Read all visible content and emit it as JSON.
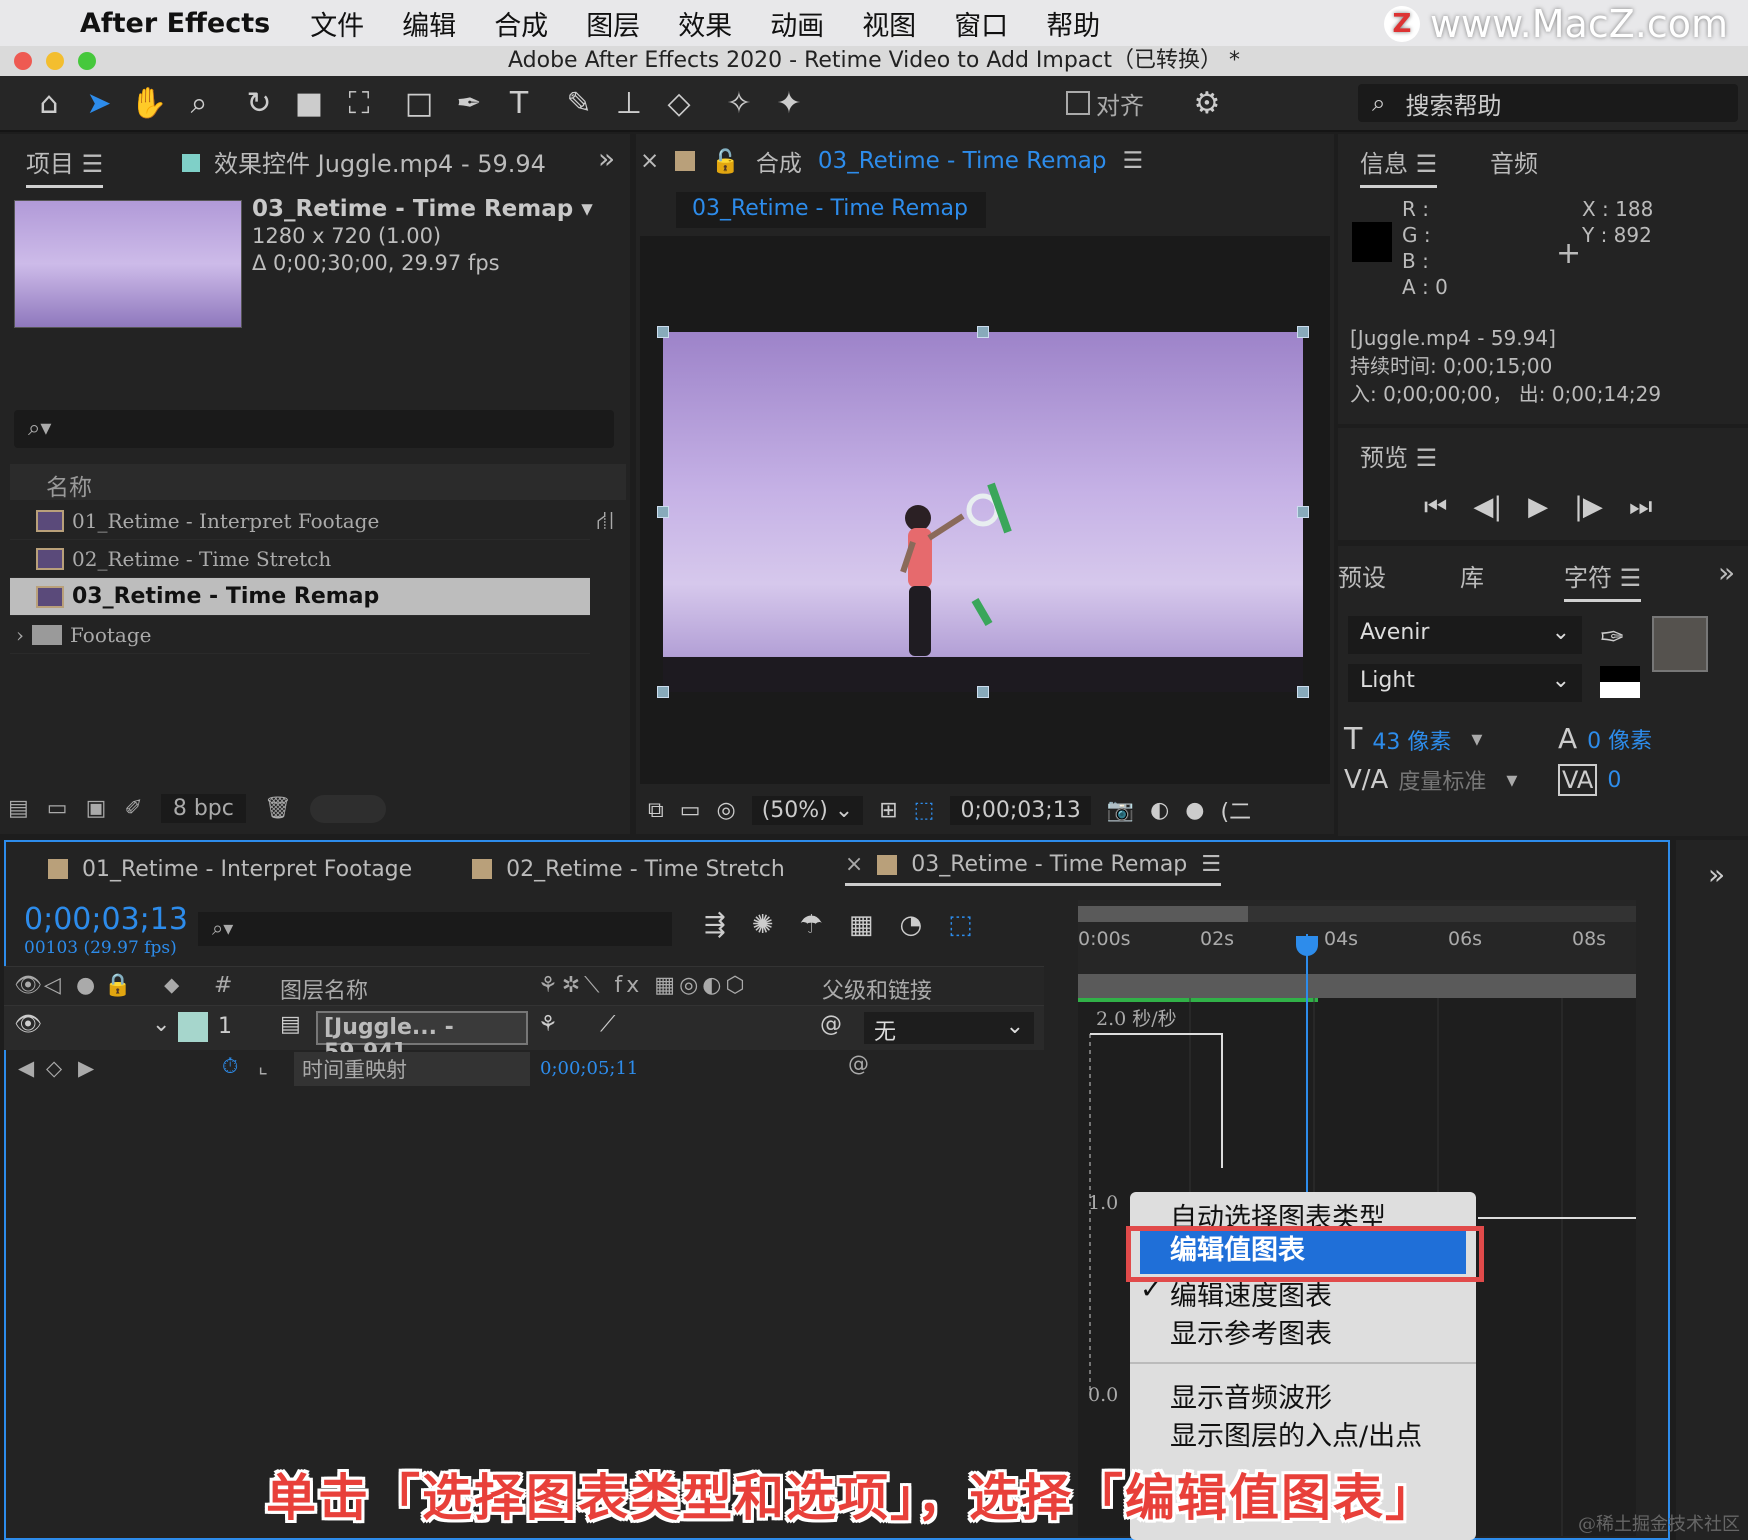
{
  "menubar": {
    "app": "After Effects",
    "items": [
      "文件",
      "编辑",
      "合成",
      "图层",
      "效果",
      "动画",
      "视图",
      "窗口",
      "帮助"
    ],
    "watermark": "www.MacZ.com",
    "watermark_badge": "Z"
  },
  "window": {
    "title": "Adobe After Effects 2020 - Retime Video to Add Impact（已转换） *"
  },
  "toolbar": {
    "align_label": "对齐",
    "search_placeholder": "搜索帮助"
  },
  "project": {
    "tab_label": "项目",
    "effects_tab": "效果控件 Juggle.mp4 - 59.94",
    "selected_name": "03_Retime - Time Remap",
    "resolution": "1280 x 720 (1.00)",
    "duration": "Δ 0;00;30;00, 29.97 fps",
    "column_name": "名称",
    "items": [
      "01_Retime - Interpret Footage",
      "02_Retime - Time Stretch",
      "03_Retime - Time Remap",
      "Footage"
    ],
    "bpc": "8 bpc"
  },
  "composition": {
    "tab_prefix": "合成",
    "tab_name": "03_Retime - Time Remap",
    "subtab": "03_Retime - Time Remap",
    "zoom": "(50%)",
    "timecode": "0;00;03;13"
  },
  "info": {
    "tab": "信息",
    "audio_tab": "音频",
    "r": "R :",
    "g": "G :",
    "b": "B :",
    "a": "A :  0",
    "x": "X : 188",
    "y": "Y : 892",
    "source": "[Juggle.mp4 - 59.94]",
    "duration": "持续时间: 0;00;15;00",
    "inout": "入: 0;00;00;00，  出: 0;00;14;29"
  },
  "preview": {
    "tab": "预览"
  },
  "character": {
    "tabs": [
      "预设",
      "库",
      "字符"
    ],
    "font": "Avenir",
    "style": "Light",
    "size": "43 像素",
    "leading": "0 像素",
    "kerning": "度量标准",
    "tracking": "0"
  },
  "timeline": {
    "tabs": [
      "01_Retime - Interpret Footage",
      "02_Retime - Time Stretch",
      "03_Retime - Time Remap"
    ],
    "time": "0;00;03;13",
    "frames": "00103 (29.97 fps)",
    "col_hash": "#",
    "col_layer_name": "图层名称",
    "col_parent": "父级和链接",
    "layer_num": "1",
    "layer_name": "[Juggle... - 59.94]",
    "parent": "无",
    "property": "时间重映射",
    "property_value": "0;00;05;11",
    "ruler": [
      "0:00s",
      "02s",
      "04s",
      "06s",
      "08s"
    ],
    "graph_speed": "2.0 秒/秒",
    "graph_1": "1.0",
    "graph_0": "0.0"
  },
  "context_menu": {
    "items": [
      "自动选择图表类型",
      "编辑值图表",
      "编辑速度图表",
      "显示参考图表",
      "显示音频波形",
      "显示图层的入点/出点"
    ],
    "highlighted": "编辑值图表",
    "checked": "编辑速度图表"
  },
  "caption": "单击「选择图表类型和选项」，选择「编辑值图表」",
  "credit": "@稀土掘金技术社区",
  "colors": {
    "accent": "#2d8ceb",
    "highlight": "#1f6fd8",
    "outline": "#e14a4a"
  }
}
